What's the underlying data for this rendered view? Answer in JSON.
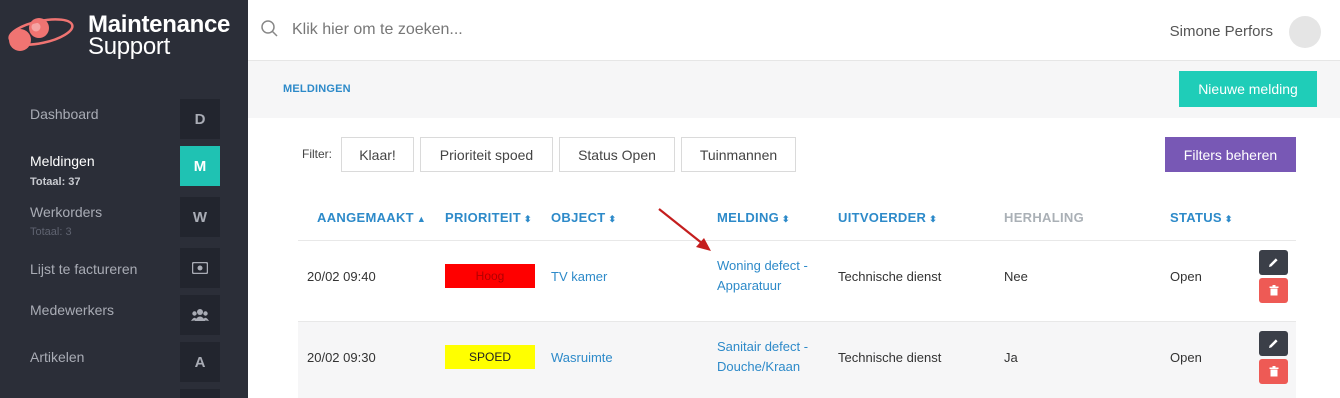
{
  "brand": {
    "title": "Maintenance",
    "subtitle": "Support"
  },
  "colors": {
    "accent": "#1fc2b3",
    "link": "#2d8ac9",
    "purple": "#7858b5",
    "danger": "#ee5a55",
    "sidebar": "#2b2e38"
  },
  "sidebar": {
    "items": [
      {
        "label": "Dashboard",
        "badge": "D",
        "sub": "",
        "active": false
      },
      {
        "label": "Meldingen",
        "badge": "M",
        "sub": "Totaal: 37",
        "active": true
      },
      {
        "label": "Werkorders",
        "badge": "W",
        "sub": "Totaal: 3",
        "active": false
      },
      {
        "label": "Lijst te factureren",
        "badge_icon": "money-icon",
        "sub": "",
        "active": false
      },
      {
        "label": "Medewerkers",
        "badge_icon": "users-icon",
        "sub": "",
        "active": false
      },
      {
        "label": "Artikelen",
        "badge": "A",
        "sub": "",
        "active": false
      }
    ]
  },
  "search": {
    "placeholder": "Klik hier om te zoeken..."
  },
  "user": {
    "name": "Simone Perfors"
  },
  "breadcrumb": "MELDINGEN",
  "new_button": "Nieuwe melding",
  "filter": {
    "label": "Filter:",
    "buttons": [
      "Klaar!",
      "Prioriteit spoed",
      "Status Open",
      "Tuinmannen"
    ],
    "manage": "Filters beheren"
  },
  "table": {
    "headers": [
      "AANGEMAAKT",
      "PRIORITEIT",
      "OBJECT",
      "MELDING",
      "UITVOERDER",
      "HERHALING",
      "STATUS"
    ],
    "rows": [
      {
        "created": "20/02 09:40",
        "priority": "Hoog",
        "priority_color": "#ff0000",
        "object": "TV kamer",
        "melding_1": "Woning defect -",
        "melding_2": "Apparatuur",
        "executor": "Technische dienst",
        "repeat": "Nee",
        "status": "Open"
      },
      {
        "created": "20/02 09:30",
        "priority": "SPOED",
        "priority_color": "#ffff00",
        "object": "Wasruimte",
        "melding_1": "Sanitair defect -",
        "melding_2": "Douche/Kraan",
        "executor": "Technische dienst",
        "repeat": "Ja",
        "status": "Open"
      }
    ]
  }
}
